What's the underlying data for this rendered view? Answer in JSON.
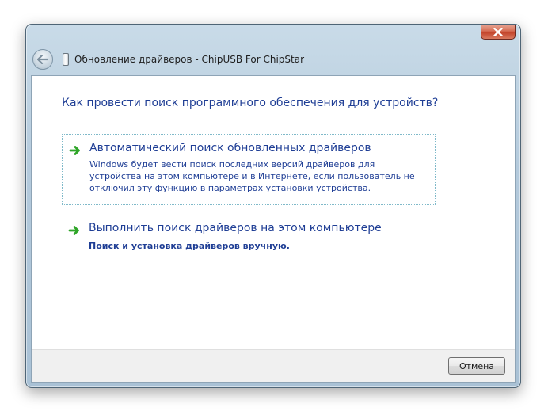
{
  "window": {
    "title": "Обновление драйверов - ChipUSB For ChipStar",
    "close_label": "✕"
  },
  "content": {
    "heading": "Как провести поиск программного обеспечения для устройств?",
    "options": [
      {
        "title": "Автоматический поиск обновленных драйверов",
        "description": "Windows будет вести поиск последних версий драйверов для устройства на этом компьютере и в Интернете, если пользователь не отключил эту функцию в параметрах установки устройства."
      },
      {
        "title": "Выполнить поиск драйверов на этом компьютере",
        "description": "Поиск и установка драйверов вручную."
      }
    ]
  },
  "footer": {
    "cancel_label": "Отмена"
  },
  "icons": {
    "back": "back-arrow-icon",
    "device": "usb-device-icon",
    "option_arrow": "green-arrow-icon"
  },
  "colors": {
    "link_text": "#1f3e95",
    "arrow_green": "#2fa528",
    "close_red": "#c3432a"
  }
}
